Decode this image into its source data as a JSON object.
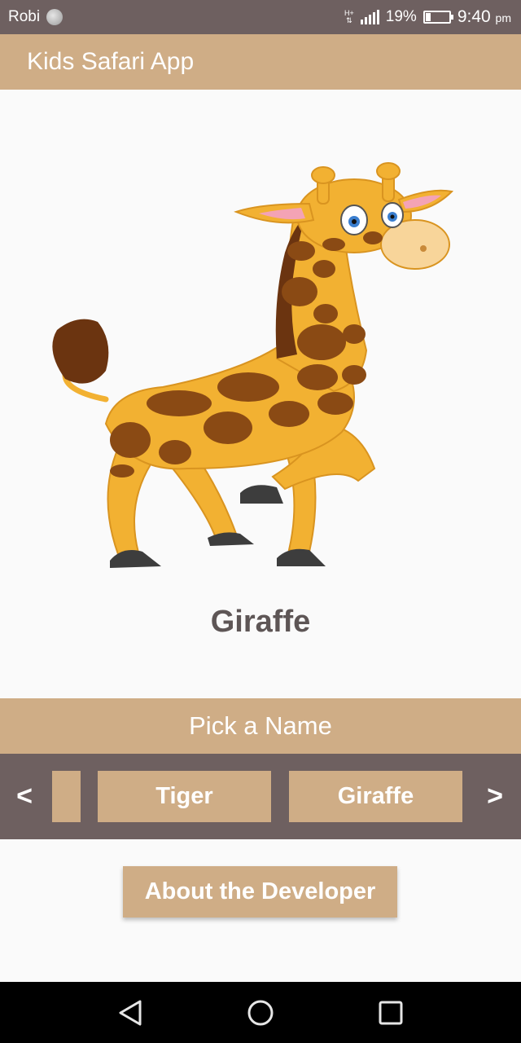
{
  "status_bar": {
    "carrier": "Robi",
    "battery_percent": "19%",
    "battery_level": 0.19,
    "time": "9:40",
    "time_suffix": "pm",
    "network_label": "H+"
  },
  "app_bar": {
    "title": "Kids Safari App"
  },
  "animal": {
    "name": "Giraffe",
    "image_icon": "giraffe-illustration"
  },
  "pick": {
    "label": "Pick a Name"
  },
  "choices": {
    "prev_label": "<",
    "next_label": ">",
    "items": [
      {
        "label": ""
      },
      {
        "label": "Tiger"
      },
      {
        "label": "Giraffe"
      }
    ]
  },
  "about": {
    "label": "About the Developer"
  },
  "nav": {
    "back_icon": "back-triangle-icon",
    "home_icon": "home-circle-icon",
    "recent_icon": "recent-apps-square-icon"
  },
  "colors": {
    "accent": "#cfad86",
    "status_bar": "#6e6060",
    "text_dark": "#5e5656",
    "background": "#fafafa"
  }
}
